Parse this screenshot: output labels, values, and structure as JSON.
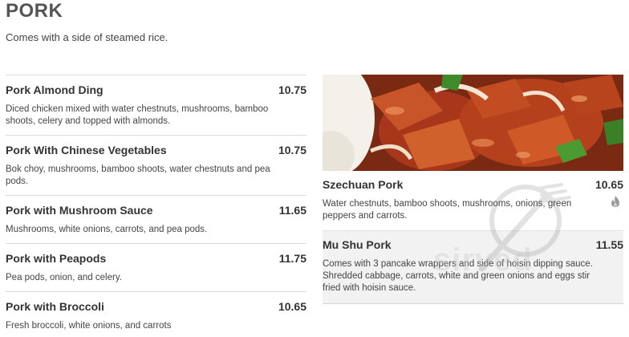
{
  "section": {
    "title": "PORK",
    "subtitle": "Comes with a side of steamed rice."
  },
  "left_items": [
    {
      "name": "Pork Almond Ding",
      "price": "10.75",
      "description": "Diced chicken mixed with water chestnuts, mushrooms, bamboo shoots, celery and topped with almonds."
    },
    {
      "name": "Pork With Chinese Vegetables",
      "price": "10.75",
      "description": "Bok choy, mushrooms, bamboo shoots, water chestnuts and pea pods."
    },
    {
      "name": "Pork with Mushroom Sauce",
      "price": "11.65",
      "description": "Mushrooms, white onions, carrots, and pea pods."
    },
    {
      "name": "Pork with Peapods",
      "price": "11.75",
      "description": "Pea pods, onion, and celery."
    },
    {
      "name": "Pork with Broccoli",
      "price": "10.65",
      "description": "Fresh broccoli, white onions, and carrots"
    }
  ],
  "right_items": [
    {
      "name": "Szechuan Pork",
      "price": "10.65",
      "description": "Water chestnuts, bamboo shoots, mushrooms, onions, green peppers and carrots.",
      "icon": "spicy-flame-icon"
    },
    {
      "name": "Mu Shu Pork",
      "price": "11.55",
      "description": "Comes with 3 pancake wrappers and side of hoisin dipping sauce. Shredded cabbage, carrots, white and green onions and eggs stir fried with hoisin sauce."
    }
  ],
  "watermark": {
    "text": "sirved",
    "icon": "fork-spoon-icon"
  },
  "colors": {
    "title": "#555555",
    "text": "#333333",
    "divider": "#dcdcdc",
    "shaded_row": "#f2f2f2"
  }
}
